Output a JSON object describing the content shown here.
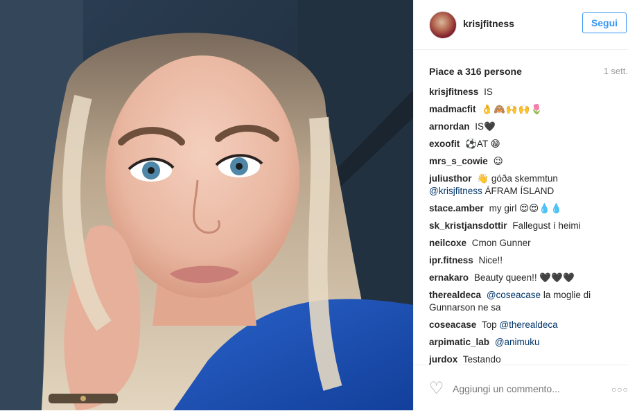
{
  "post": {
    "username": "krisjfitness",
    "follow_label": "Segui",
    "likes": "Piace a 316 persone",
    "time": "1 sett.",
    "comments": [
      {
        "user": "krisjfitness",
        "text": "IS"
      },
      {
        "user": "madmacfit",
        "text": "👌🙈🙌🙌🌷"
      },
      {
        "user": "arnordan",
        "text": "IS🖤"
      },
      {
        "user": "exoofit",
        "text": "⚽AT 😁"
      },
      {
        "user": "mrs_s_cowie",
        "text": "😉"
      },
      {
        "user": "juliusthor",
        "text": "👋 góða skemmtun",
        "mention": "@krisjfitness",
        "after": " ÁFRAM ÍSLAND"
      },
      {
        "user": "stace.amber",
        "text": "my girl 😍😍💧💧"
      },
      {
        "user": "sk_kristjansdottir",
        "text": "Fallegust í heimi"
      },
      {
        "user": "neilcoxe",
        "text": "Cmon Gunner"
      },
      {
        "user": "ipr.fitness",
        "text": "Nice!!"
      },
      {
        "user": "ernakaro",
        "text": "Beauty queen!! 🖤🖤🖤"
      },
      {
        "user": "therealdeca",
        "text": "",
        "mention": "@coseacase",
        "after": " la moglie di Gunnarson ne sa"
      },
      {
        "user": "coseacase",
        "text": "Top ",
        "mention": "@therealdeca",
        "after": ""
      },
      {
        "user": "arpimatic_lab",
        "text": "",
        "mention": "@animuku",
        "after": ""
      },
      {
        "user": "jurdox",
        "text": "Testando",
        "after": ""
      }
    ],
    "add_comment_placeholder": "Aggiungi un commento...",
    "icons": {
      "like": "heart-icon",
      "more": "more-options-icon"
    }
  }
}
